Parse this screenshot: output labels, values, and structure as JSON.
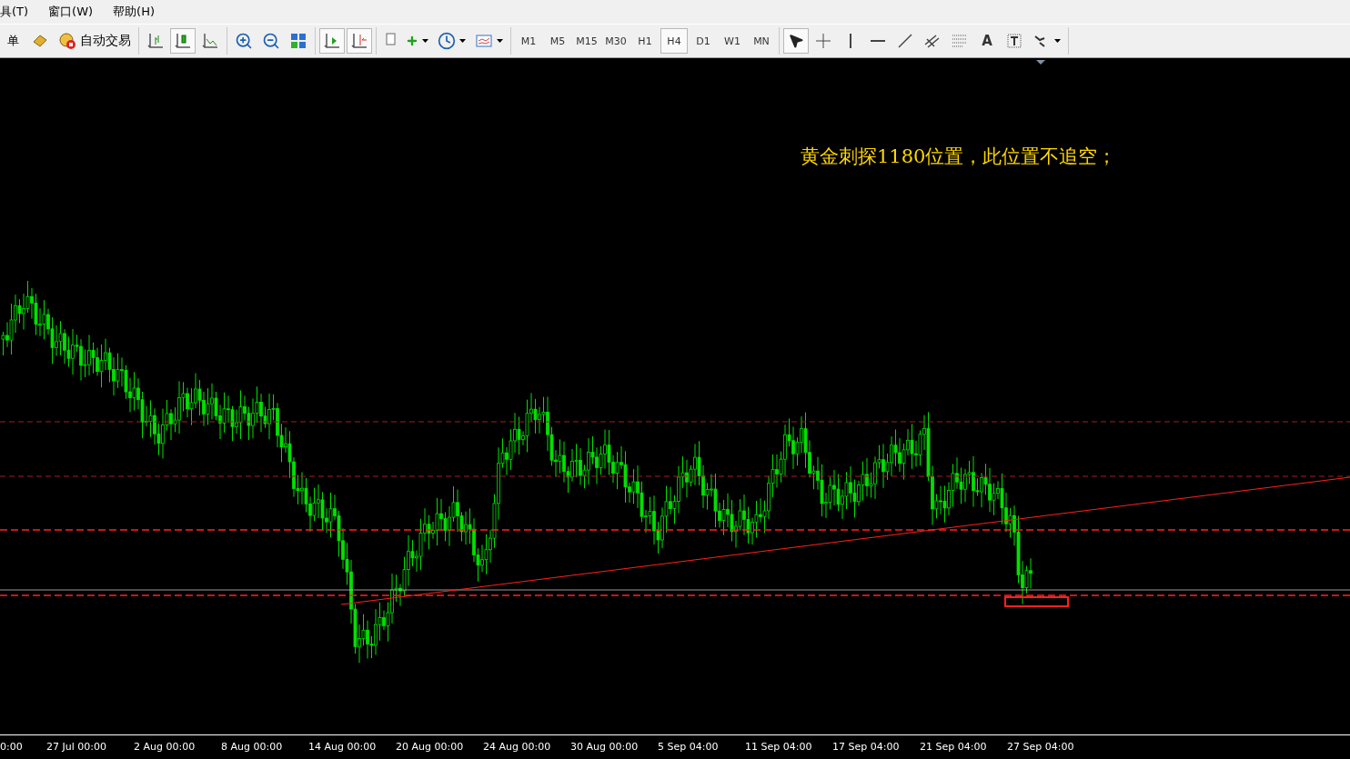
{
  "menu": [
    {
      "label": "具(T)"
    },
    {
      "label": "窗口(W)"
    },
    {
      "label": "帮助(H)"
    }
  ],
  "toolbar": {
    "order_label": "单",
    "autotrade_label": "自动交易",
    "chart_types": [
      {
        "selected": false
      },
      {
        "selected": true
      },
      {
        "selected": false
      }
    ],
    "autoscroll": {
      "selected": true
    },
    "chart_shift": {
      "selected": true
    },
    "timeframes": [
      {
        "label": "M1",
        "selected": false
      },
      {
        "label": "M5",
        "selected": false
      },
      {
        "label": "M15",
        "selected": false
      },
      {
        "label": "M30",
        "selected": false
      },
      {
        "label": "H1",
        "selected": false
      },
      {
        "label": "H4",
        "selected": true
      },
      {
        "label": "D1",
        "selected": false
      },
      {
        "label": "W1",
        "selected": false
      },
      {
        "label": "MN",
        "selected": false
      }
    ],
    "cursor": {
      "selected": true
    },
    "crosshair": {
      "selected": false
    },
    "text_tool_label": "A"
  },
  "chart": {
    "annotation": "黄金刺探1180位置，此位置不追空；",
    "time_labels": [
      "0:00",
      "27 Jul 00:00",
      "2 Aug 00:00",
      "8 Aug 00:00",
      "14 Aug 00:00",
      "20 Aug 00:00",
      "24 Aug 00:00",
      "30 Aug 00:00",
      "5 Sep 04:00",
      "11 Sep 04:00",
      "17 Sep 04:00",
      "21 Sep 04:00",
      "27 Sep 04:00"
    ]
  }
}
